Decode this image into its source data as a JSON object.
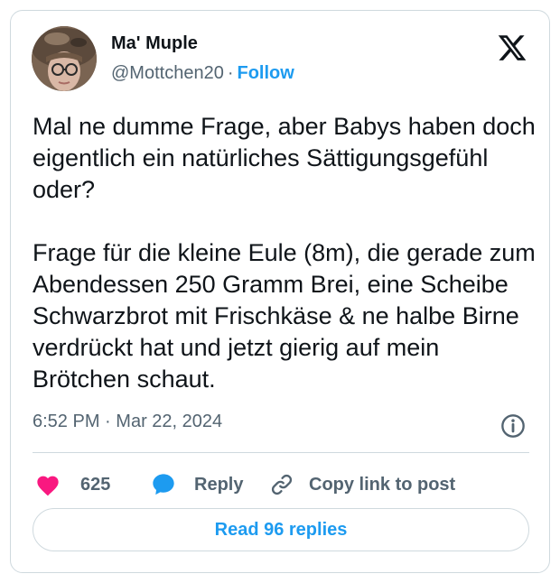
{
  "author": {
    "display_name": "Ma' Muple",
    "handle": "@Mottchen20",
    "separator": "·",
    "follow_label": "Follow"
  },
  "tweet": {
    "paragraph_1": "Mal ne dumme Frage, aber Babys haben doch eigentlich ein natürliches Sättigungsgefühl oder?",
    "paragraph_2": "Frage für die kleine Eule (8m), die gerade zum Abendessen 250 Gramm Brei, eine Scheibe Schwarzbrot mit Frischkäse & ne halbe Birne verdrückt hat und jetzt gierig auf mein Brötchen schaut.",
    "time": "6:52 PM",
    "separator": "·",
    "date": "Mar 22, 2024"
  },
  "actions": {
    "like_count": "625",
    "reply_label": "Reply",
    "copy_link_label": "Copy link to post"
  },
  "read_replies_label": "Read 96 replies",
  "colors": {
    "accent": "#1d9bf0",
    "like": "#f91880",
    "text": "#0f1419",
    "muted": "#536471",
    "border": "#cfd9de"
  },
  "icons": [
    "x-logo-icon",
    "info-icon",
    "heart-icon",
    "reply-bubble-icon",
    "link-icon"
  ]
}
